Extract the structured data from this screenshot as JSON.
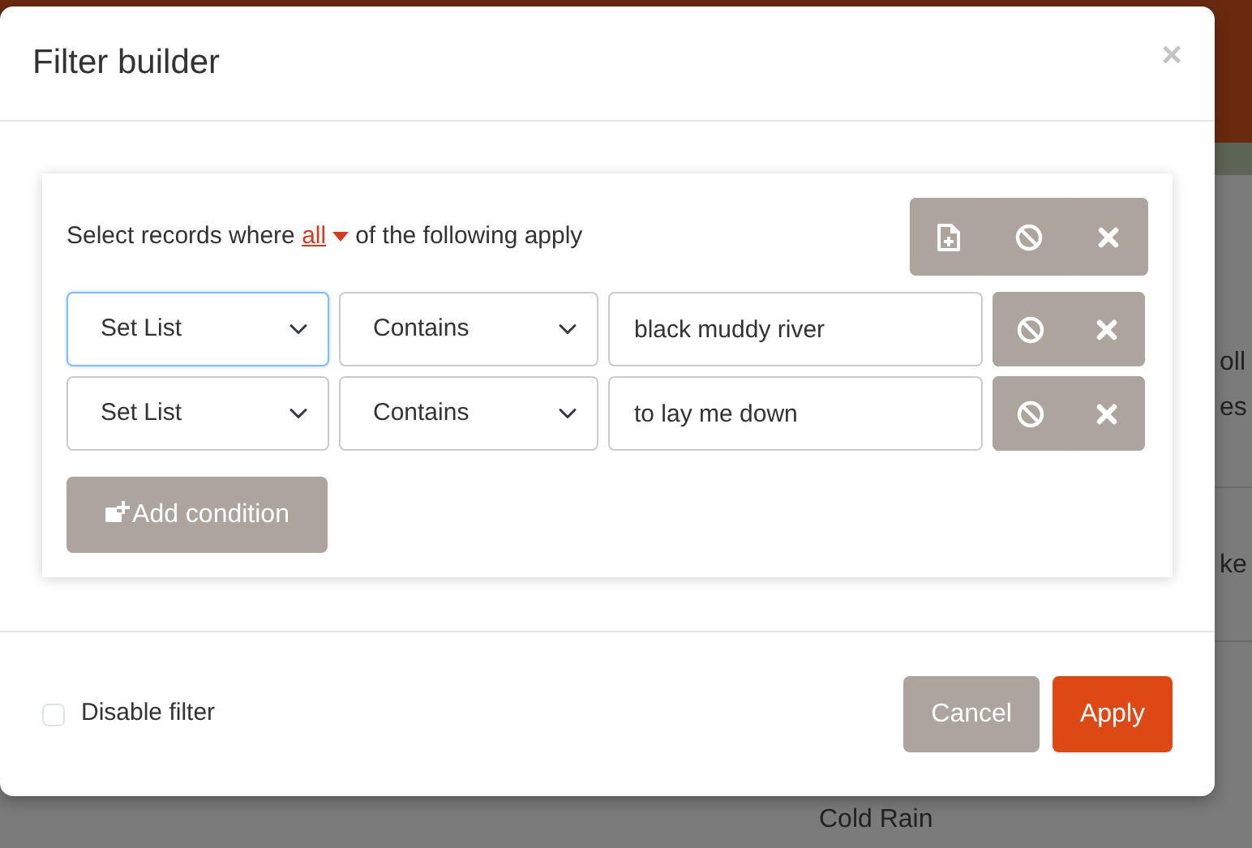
{
  "background": {
    "fragments": [
      "oll",
      "es",
      "ke",
      "Cold Rain"
    ]
  },
  "modal": {
    "title": "Filter builder",
    "close": "×",
    "match": {
      "prefix": "Select records where",
      "mode": "all",
      "suffix": "of the following apply"
    },
    "conditions": [
      {
        "field": "Set List",
        "operator": "Contains",
        "value": "black muddy river",
        "focused": true
      },
      {
        "field": "Set List",
        "operator": "Contains",
        "value": "to lay me down",
        "focused": false
      }
    ],
    "add_button": "Add condition",
    "disable_filter": {
      "label": "Disable filter",
      "checked": false
    },
    "buttons": [
      {
        "label": "Cancel",
        "kind": "secondary"
      },
      {
        "label": "Apply",
        "kind": "primary"
      }
    ]
  }
}
